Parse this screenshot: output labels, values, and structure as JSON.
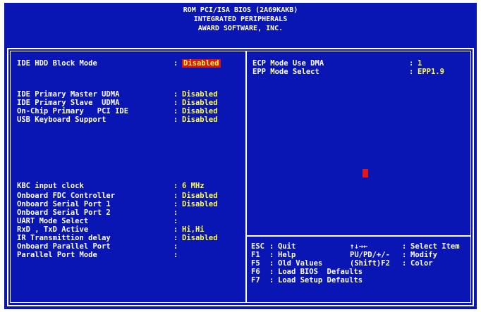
{
  "header": {
    "line1": "ROM PCI/ISA BIOS (2A69KAKB)",
    "line2": "INTEGRATED PERIPHERALS",
    "line3": "AWARD SOFTWARE, INC."
  },
  "left_settings": [
    {
      "label": "IDE HDD Block Mode",
      "value": "Disabled",
      "selected": true
    },
    {
      "label": "IDE Primary Master UDMA",
      "value": "Disabled"
    },
    {
      "label": "IDE Primary Slave  UDMA",
      "value": "Disabled"
    },
    {
      "label": "On-Chip Primary   PCI IDE",
      "value": "Disabled"
    },
    {
      "label": "USB Keyboard Support",
      "value": "Disabled"
    },
    {
      "label": "KBC input clock",
      "value": "6 MHz"
    },
    {
      "label": "Onboard FDC Controller",
      "value": "Disabled"
    },
    {
      "label": "Onboard Serial Port 1",
      "value": "Disabled"
    },
    {
      "label": "Onboard Serial Port 2",
      "value": ""
    },
    {
      "label": "UART Mode Select",
      "value": ""
    },
    {
      "label": "RxD , TxD Active",
      "value": "Hi,Hi"
    },
    {
      "label": "IR Transmittion delay",
      "value": "Disabled"
    },
    {
      "label": "Onboard Parallel Port",
      "value": ""
    },
    {
      "label": "Parallel Port Mode",
      "value": ""
    }
  ],
  "right_settings": [
    {
      "label": "ECP Mode Use DMA",
      "value": "1"
    },
    {
      "label": "EPP Mode Select",
      "value": "EPP1.9"
    }
  ],
  "help": [
    {
      "key": "ESC",
      "desc": "Quit",
      "key2": "↑↓→←",
      "desc2": "Select Item"
    },
    {
      "key": "F1",
      "desc": "Help",
      "key2": "PU/PD/+/-",
      "desc2": "Modify"
    },
    {
      "key": "F5",
      "desc": "Old Values",
      "key2": "(Shift)F2",
      "desc2": "Color"
    },
    {
      "key": "F6",
      "desc": "Load BIOS  Defaults",
      "key2": "",
      "desc2": ""
    },
    {
      "key": "F7",
      "desc": "Load Setup Defaults",
      "key2": "",
      "desc2": ""
    }
  ],
  "colors": {
    "background": "#0a16b4",
    "text": "#ffffff",
    "value": "#ffff3c",
    "highlight": "#d81414"
  }
}
